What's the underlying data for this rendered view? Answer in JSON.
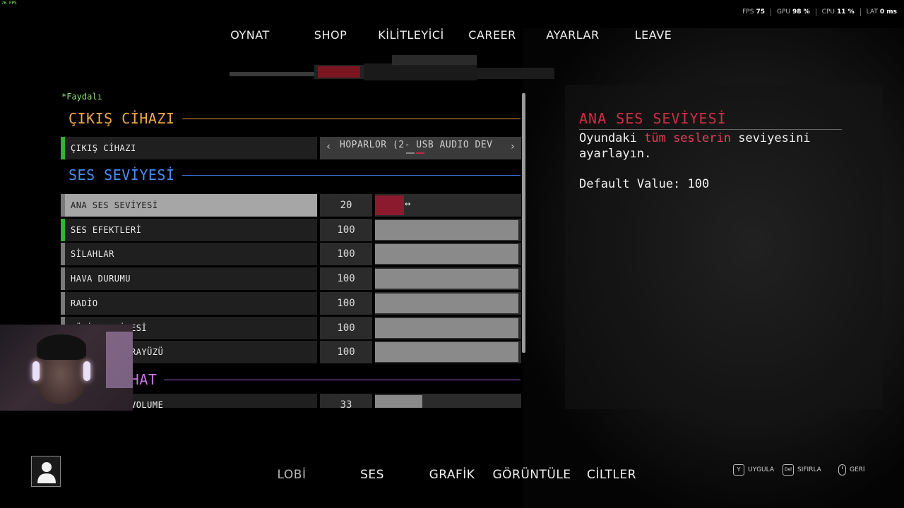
{
  "fps_counter": "76 FPS",
  "stats": [
    {
      "label": "FPS",
      "value": "75"
    },
    {
      "label": "GPU",
      "value": "98 %"
    },
    {
      "label": "CPU",
      "value": "11 %"
    },
    {
      "label": "LAT",
      "value": "0 ms"
    }
  ],
  "topnav": [
    "OYNAT",
    "SHOP",
    "KİLİTLEYİCİ",
    "CAREER",
    "AYARLAR",
    "LEAVE"
  ],
  "panel": {
    "useful_label": "*Faydalı",
    "section_output": "ÇIKIŞ CİHAZI",
    "output_row_label": "ÇIKIŞ CİHAZI",
    "output_device_value": "HOPARLOR (2- USB AUDIO DEV",
    "section_volume": "SES SEVİYESİ",
    "volume_rows": [
      {
        "label": "ANA SES SEVİYESİ",
        "value": "20",
        "fill": 0.2
      },
      {
        "label": "SES EFEKTLERİ",
        "value": "100",
        "fill": 1.0
      },
      {
        "label": "SİLAHLAR",
        "value": "100",
        "fill": 1.0
      },
      {
        "label": "HAVA DURUMU",
        "value": "100",
        "fill": 1.0
      },
      {
        "label": "RADİO",
        "value": "100",
        "fill": 1.0
      },
      {
        "label": "MÜZİK SEVİYESİ",
        "value": "100",
        "fill": 1.0
      },
      {
        "label": "KULLANICI ARAYÜZÜ",
        "value": "100",
        "fill": 1.0
      }
    ],
    "section_voice": "VOICE CHAT",
    "voice_row": {
      "label": "VOICE CHAT VOLUME",
      "value": "33",
      "fill": 0.33
    }
  },
  "info": {
    "title": "ANA SES SEVİYESİ",
    "desc_pre": "Oyundaki ",
    "desc_hl": "tüm seslerin",
    "desc_post": " seviyesini ayarlayın.",
    "default_value": "Default Value: 100"
  },
  "bottomnav": [
    "LOBİ",
    "SES",
    "GRAFİK",
    "GÖRÜNTÜLE",
    "CİLTLER"
  ],
  "hints": [
    {
      "key": "Y",
      "label": "UYGULA"
    },
    {
      "key": "Del",
      "label": "SIFIRLA"
    },
    {
      "key": "mouse",
      "label": "GERİ"
    }
  ],
  "colors": {
    "accent_red": "#d12d45",
    "slider_active": "#8c1a2f",
    "orange": "#f0a848",
    "blue": "#4a8ef5",
    "purple": "#c876e0"
  }
}
